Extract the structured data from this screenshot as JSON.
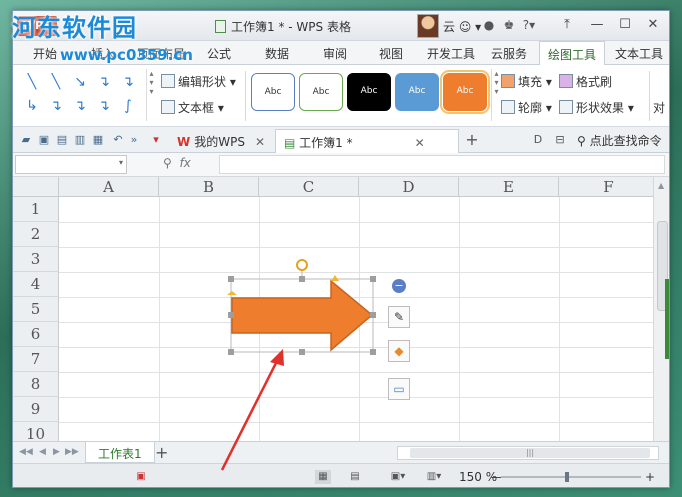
{
  "window": {
    "app_badge": "WPS",
    "title": "工作簿1 * - WPS 表格",
    "user": "云",
    "win_buttons": [
      "—",
      "☐",
      "✕"
    ]
  },
  "menu": {
    "tabs": [
      "开始",
      "插入",
      "页面布局",
      "公式",
      "数据",
      "审阅",
      "视图",
      "开发工具",
      "云服务",
      "绘图工具",
      "文本工具"
    ],
    "active": "绘图工具"
  },
  "ribbon": {
    "shape_icons": [
      "╲",
      "╲",
      "↘",
      "↴",
      "↴",
      "↳",
      "↴",
      "↴",
      "↴",
      "∫"
    ],
    "edit_shape": "编辑形状",
    "text_box": "文本框",
    "style_label": "Abc",
    "fill": "填充",
    "format_brush": "格式刷",
    "outline": "轮廓",
    "shape_effects": "形状效果",
    "align": "对"
  },
  "docbar": {
    "my_wps": "我的WPS",
    "workbook_tab": "工作簿1 *",
    "add": "+",
    "search": "点此查找命令"
  },
  "formula": {
    "fx": "fx"
  },
  "grid": {
    "columns": [
      "A",
      "B",
      "C",
      "D",
      "E",
      "F"
    ],
    "rows": [
      "1",
      "2",
      "3",
      "4",
      "5",
      "6",
      "7",
      "8",
      "9",
      "10"
    ]
  },
  "sheets": {
    "tabs": [
      "工作表1"
    ],
    "add": "+"
  },
  "status": {
    "zoom": "150 %",
    "zoom_minus": "—",
    "zoom_plus": "+"
  },
  "watermark": {
    "text": "河东软件园",
    "url": "www.pc0359.cn"
  },
  "colors": {
    "arrow_fill": "#ee7d2e",
    "arrow_stroke": "#c8641f",
    "accent_green": "#2b7a2b",
    "annotation_red": "#e0312a",
    "style_black": "#000000",
    "style_blue": "#5b9bd5",
    "style_orange": "#ee7d2e"
  }
}
